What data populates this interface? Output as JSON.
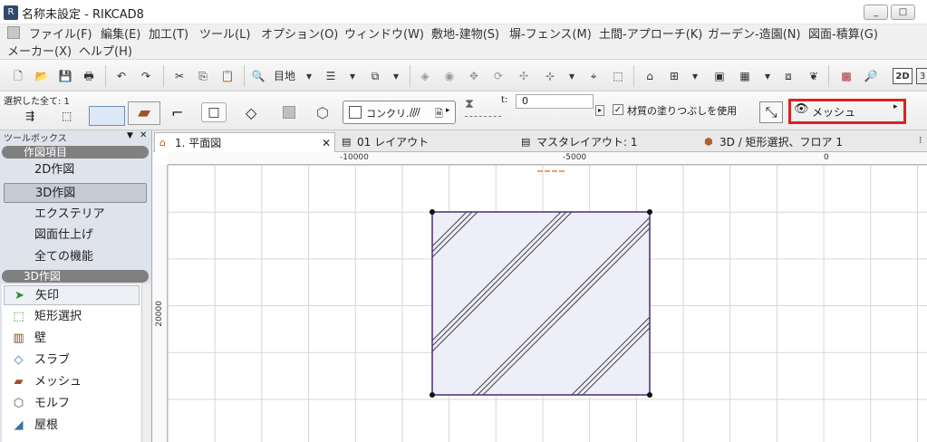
{
  "window": {
    "title": "名称未設定 - RIKCAD8",
    "buttons": [
      "_",
      "□",
      "✕"
    ]
  },
  "menu": [
    "ファイル(F)",
    "編集(E)",
    "加工(T)",
    "ツール(L)",
    "オプション(O)",
    "ウィンドウ(W)",
    "敷地-建物(S)",
    "塀-フェンス(M)",
    "土間-アプローチ(K)",
    "ガーデン-造園(N)",
    "図面-積算(G)",
    "メーカー(X)",
    "ヘルプ(H)"
  ],
  "infobox": {
    "selection_label": "選択した全て: 1",
    "material_label": "コンクリ...",
    "t_label": "t:",
    "t_value": "0",
    "checkbox_label": "材質の塗りつぶしを使用",
    "mesh_label": "メッシュ"
  },
  "toolbox": {
    "title": "ツールボックス",
    "section1": "作図項目",
    "nav": [
      "2D作図",
      "3D作図",
      "エクステリア",
      "図面仕上げ",
      "全ての機能"
    ],
    "section2": "3D作図",
    "tools": [
      "矢印",
      "矩形選択",
      "壁",
      "スラブ",
      "メッシュ",
      "モルフ",
      "屋根"
    ]
  },
  "tabs": [
    "1. 平面図",
    "01 レイアウト",
    "マスタレイアウト: 1",
    "3D / 矩形選択、フロア 1"
  ],
  "canvas": {
    "ruler_h": [
      "-10000",
      "-5000",
      "0"
    ],
    "ruler_v": "20000"
  },
  "colors": {
    "highlight": "#e02020",
    "mesh_fill": "#eeeef8",
    "mesh_stroke": "#4b2a7a"
  }
}
